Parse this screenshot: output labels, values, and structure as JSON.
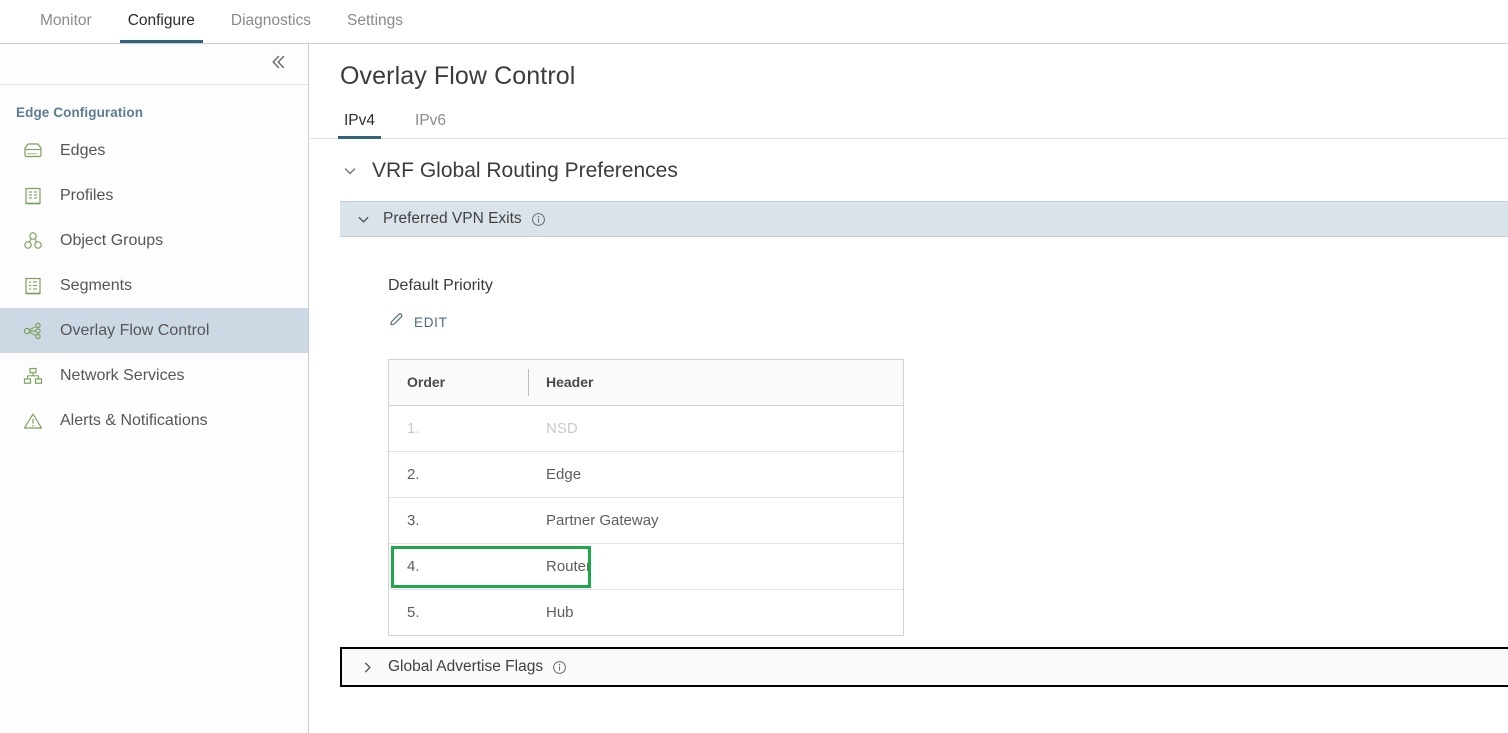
{
  "topnav": {
    "tabs": [
      {
        "label": "Monitor",
        "active": false
      },
      {
        "label": "Configure",
        "active": true
      },
      {
        "label": "Diagnostics",
        "active": false
      },
      {
        "label": "Settings",
        "active": false
      }
    ]
  },
  "sidebar": {
    "collapse_icon": "chevron-double-left-icon",
    "heading": "Edge Configuration",
    "items": [
      {
        "label": "Edges",
        "icon": "edge-device-icon",
        "selected": false
      },
      {
        "label": "Profiles",
        "icon": "profile-document-icon",
        "selected": false
      },
      {
        "label": "Object Groups",
        "icon": "object-groups-icon",
        "selected": false
      },
      {
        "label": "Segments",
        "icon": "segments-document-icon",
        "selected": false
      },
      {
        "label": "Overlay Flow Control",
        "icon": "share-nodes-icon",
        "selected": true
      },
      {
        "label": "Network Services",
        "icon": "network-hierarchy-icon",
        "selected": false
      },
      {
        "label": "Alerts & Notifications",
        "icon": "alert-triangle-icon",
        "selected": false
      }
    ]
  },
  "main": {
    "page_title": "Overlay Flow Control",
    "subtabs": [
      {
        "label": "IPv4",
        "active": true
      },
      {
        "label": "IPv6",
        "active": false
      }
    ],
    "section": {
      "title": "VRF Global Routing Preferences",
      "chevron": "chevron-down-icon"
    },
    "preferred_vpn_exits": {
      "label": "Preferred VPN Exits",
      "chevron": "chevron-down-icon",
      "info_icon": "info-circle-icon",
      "field_label": "Default Priority",
      "edit_label": "EDIT",
      "edit_icon": "pencil-icon",
      "table": {
        "columns": [
          "Order",
          "Header"
        ],
        "rows": [
          {
            "order": "1.",
            "header": "NSD",
            "disabled": true
          },
          {
            "order": "2.",
            "header": "Edge",
            "disabled": false
          },
          {
            "order": "3.",
            "header": "Partner Gateway",
            "disabled": false
          },
          {
            "order": "4.",
            "header": "Router",
            "disabled": false,
            "highlighted": true
          },
          {
            "order": "5.",
            "header": "Hub",
            "disabled": false
          }
        ]
      }
    },
    "global_advertise_flags": {
      "label": "Global Advertise Flags",
      "chevron": "chevron-right-icon",
      "info_icon": "info-circle-icon"
    }
  },
  "colors": {
    "accent_tab_underline": "#31647d",
    "sidebar_selected_bg": "#ccd9e5",
    "panel_bar_bg": "#dbe3ea",
    "icon_green": "#7ba05b",
    "highlight_green": "#1fa84b",
    "link_blue": "#4d6b80"
  }
}
